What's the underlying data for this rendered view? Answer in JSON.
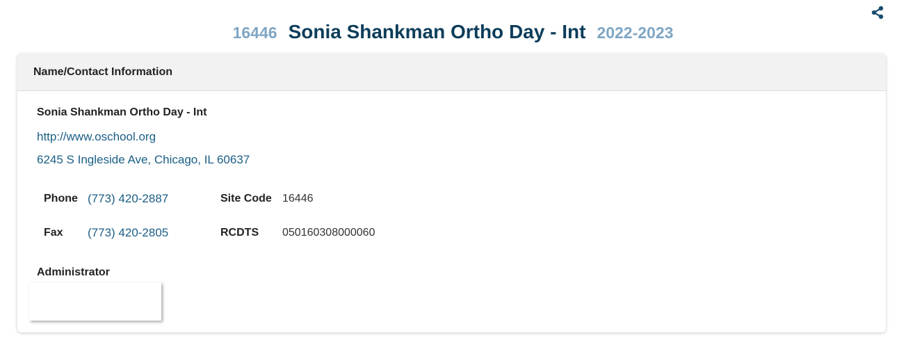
{
  "header": {
    "share_icon": "share-icon",
    "school_code": "16446",
    "school_name": "Sonia Shankman Ortho Day - Int",
    "school_year": "2022-2023"
  },
  "card": {
    "title": "Name/Contact Information",
    "school_name": "Sonia Shankman Ortho Day - Int",
    "website": "http://www.oschool.org",
    "address": "6245 S Ingleside Ave, Chicago, IL 60637",
    "phone_label": "Phone",
    "phone_value": "(773) 420-2887",
    "fax_label": "Fax",
    "fax_value": "(773) 420-2805",
    "site_code_label": "Site Code",
    "site_code_value": "16446",
    "rcdts_label": "RCDTS",
    "rcdts_value": "050160308000060",
    "administrator_label": "Administrator"
  },
  "colors": {
    "title": "#0d3d5a",
    "muted_title": "#7fa6c4",
    "link": "#1a5e85",
    "header_bg": "#f2f2f2"
  }
}
